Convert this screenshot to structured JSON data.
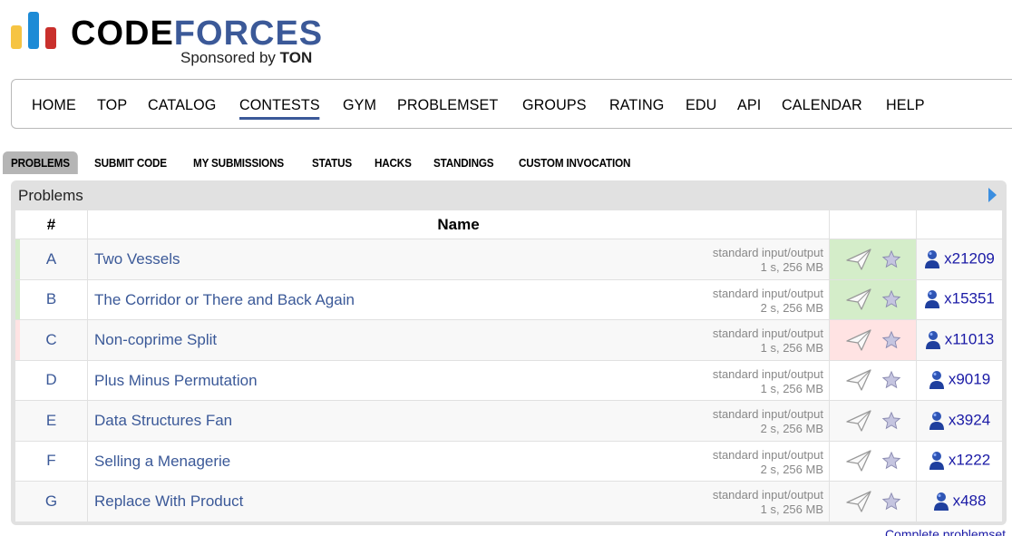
{
  "logo": {
    "code": "CODE",
    "forces": "FORCES",
    "sponsored_prefix": "Sponsored by",
    "sponsor": "TON",
    "colors": {
      "yellow": "#f6c443",
      "blue": "#1d8bd6",
      "red": "#c9302c",
      "brand": "#3b5998"
    }
  },
  "main_menu": {
    "items": [
      "HOME",
      "TOP",
      "CATALOG",
      "CONTESTS",
      "GYM",
      "PROBLEMSET",
      "GROUPS",
      "RATING",
      "EDU",
      "API",
      "CALENDAR",
      "HELP"
    ],
    "active": "CONTESTS"
  },
  "second_menu": {
    "items": [
      "PROBLEMS",
      "SUBMIT CODE",
      "MY SUBMISSIONS",
      "STATUS",
      "HACKS",
      "STANDINGS",
      "CUSTOM INVOCATION"
    ],
    "selected": "PROBLEMS"
  },
  "problems_box": {
    "title": "Problems",
    "columns": {
      "index": "#",
      "name": "Name",
      "actions": "",
      "solved": ""
    },
    "rows": [
      {
        "index": "A",
        "name": "Two Vessels",
        "io": "standard input/output",
        "limits": "1 s, 256 MB",
        "solved": "x21209",
        "status": "accepted"
      },
      {
        "index": "B",
        "name": "The Corridor or There and Back Again",
        "io": "standard input/output",
        "limits": "2 s, 256 MB",
        "solved": "x15351",
        "status": "accepted"
      },
      {
        "index": "C",
        "name": "Non-coprime Split",
        "io": "standard input/output",
        "limits": "1 s, 256 MB",
        "solved": "x11013",
        "status": "rejected"
      },
      {
        "index": "D",
        "name": "Plus Minus Permutation",
        "io": "standard input/output",
        "limits": "1 s, 256 MB",
        "solved": "x9019",
        "status": "none"
      },
      {
        "index": "E",
        "name": "Data Structures Fan",
        "io": "standard input/output",
        "limits": "2 s, 256 MB",
        "solved": "x3924",
        "status": "none"
      },
      {
        "index": "F",
        "name": "Selling a Menagerie",
        "io": "standard input/output",
        "limits": "2 s, 256 MB",
        "solved": "x1222",
        "status": "none"
      },
      {
        "index": "G",
        "name": "Replace With Product",
        "io": "standard input/output",
        "limits": "1 s, 256 MB",
        "solved": "x488",
        "status": "none"
      }
    ]
  },
  "footer": {
    "link": "Complete problemset"
  },
  "icons": {
    "submit": "paper-plane-icon",
    "favourite": "star-icon",
    "solvers": "user-icon",
    "expand": "arrow-right-icon"
  }
}
